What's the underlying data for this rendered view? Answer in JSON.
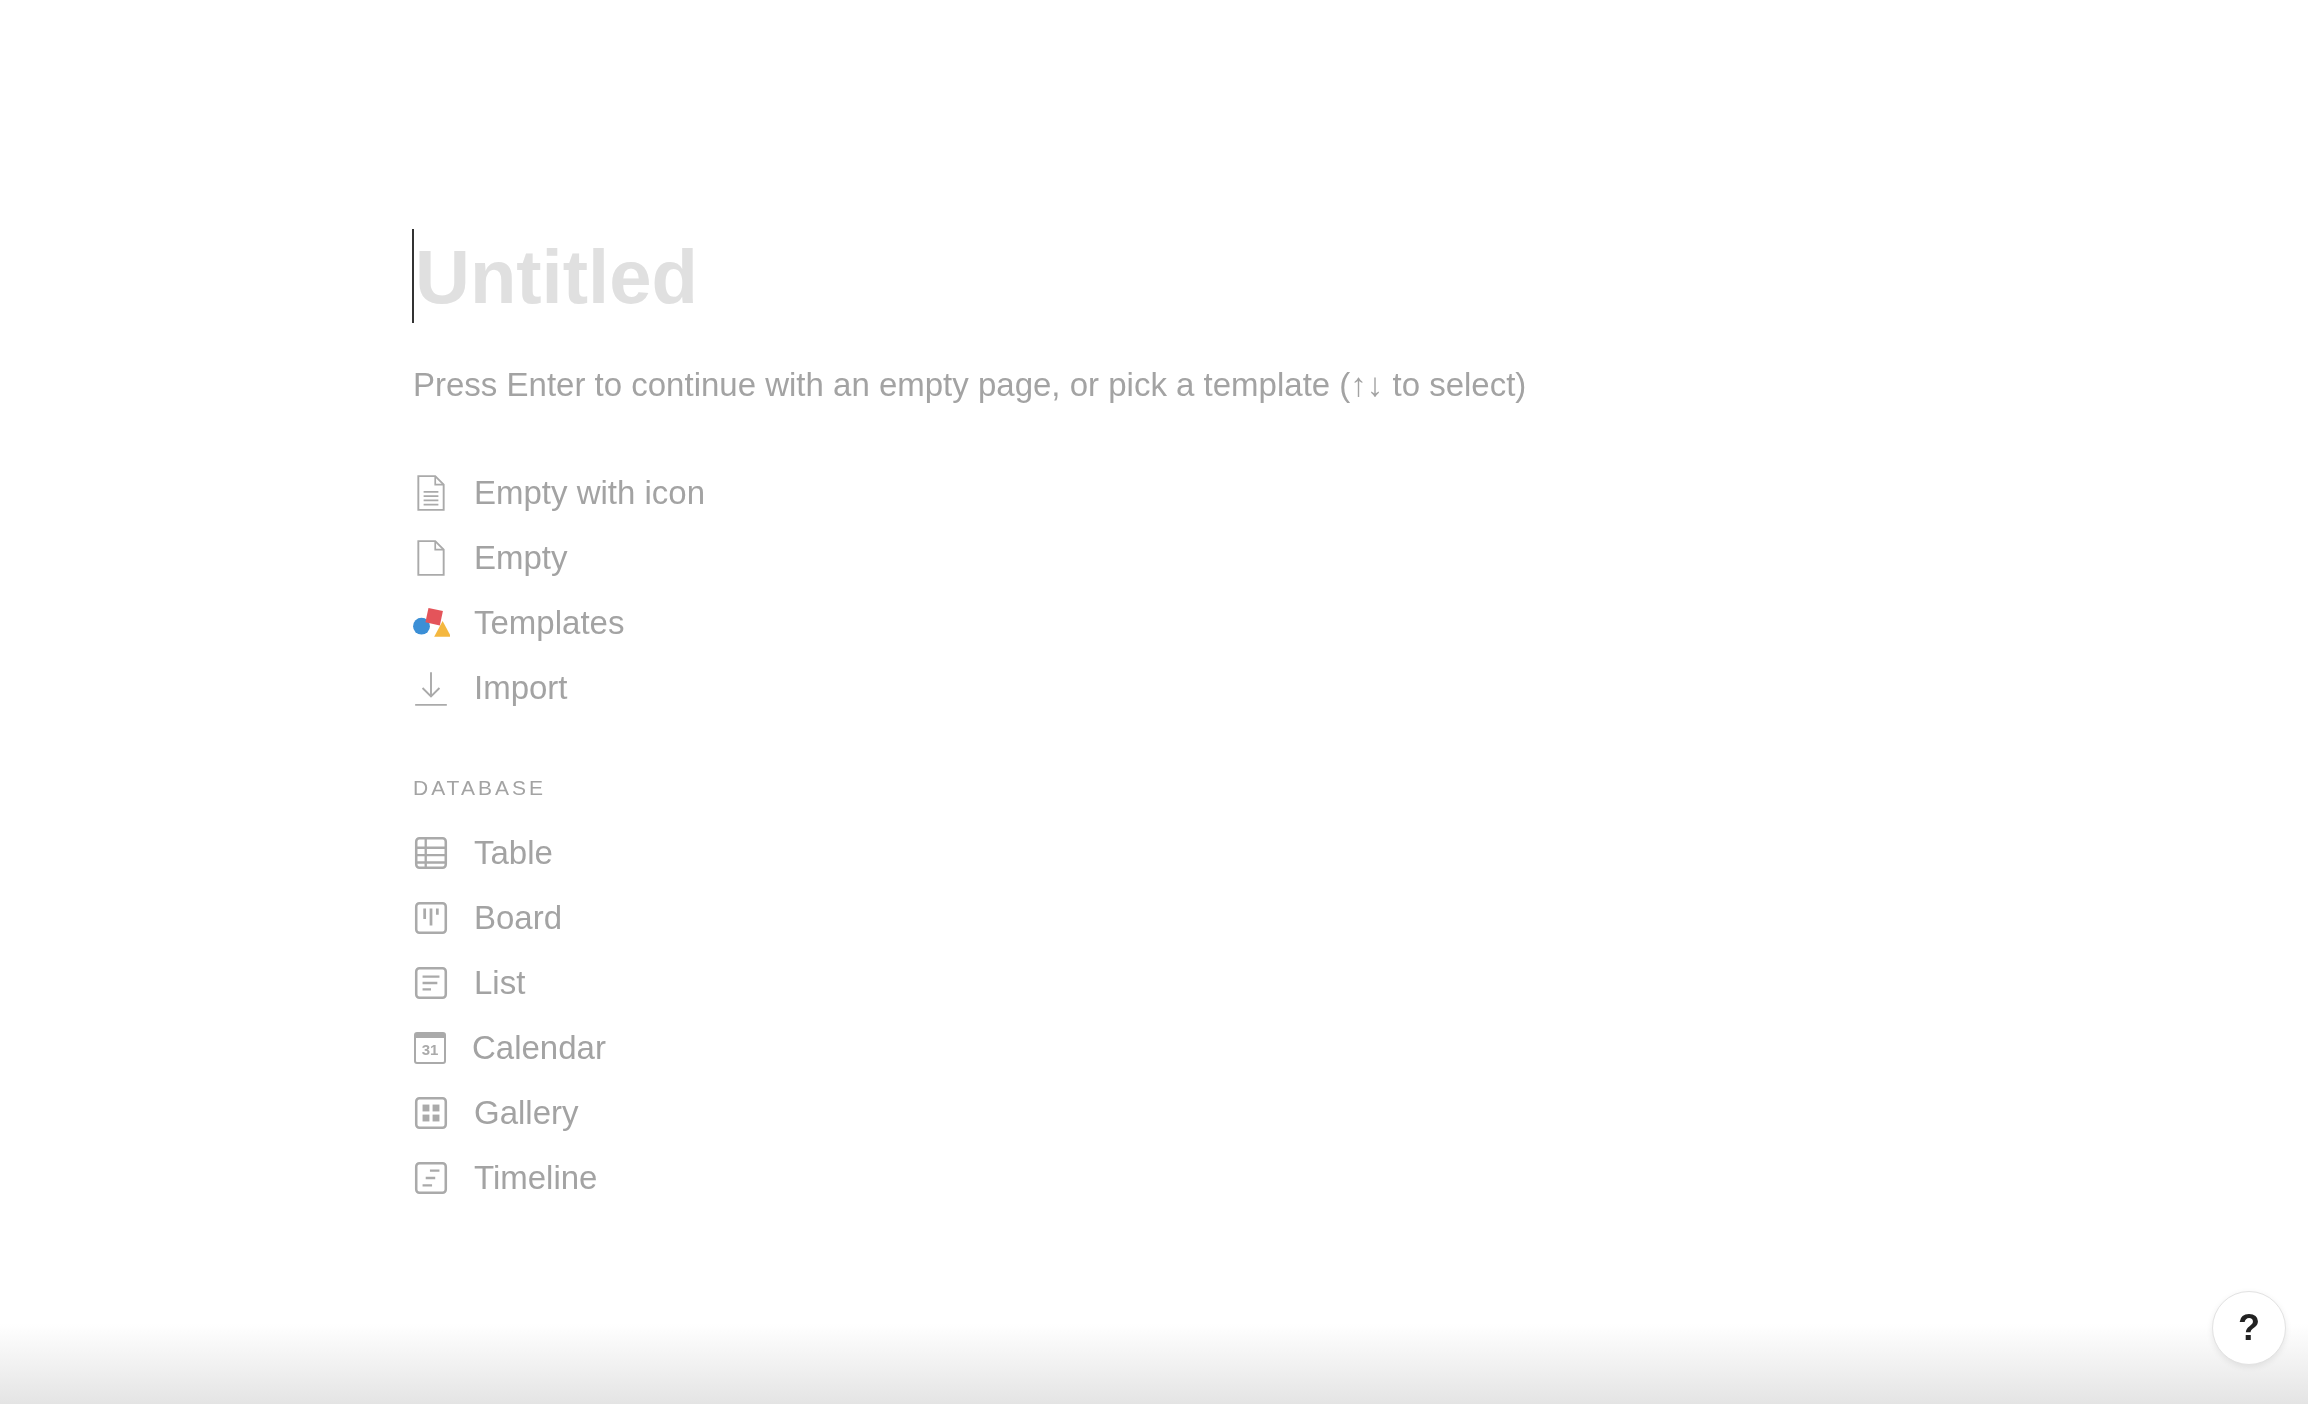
{
  "page": {
    "title_placeholder": "Untitled",
    "hint": "Press Enter to continue with an empty page, or pick a template (↑↓ to select)"
  },
  "options": [
    {
      "kind": "doc-lines",
      "label": "Empty with icon"
    },
    {
      "kind": "doc",
      "label": "Empty"
    },
    {
      "kind": "shapes",
      "label": "Templates"
    },
    {
      "kind": "download",
      "label": "Import"
    }
  ],
  "database": {
    "heading": "DATABASE",
    "items": [
      {
        "kind": "table",
        "label": "Table"
      },
      {
        "kind": "board",
        "label": "Board"
      },
      {
        "kind": "list",
        "label": "List"
      },
      {
        "kind": "calendar",
        "label": "Calendar",
        "icon_text": "31"
      },
      {
        "kind": "gallery",
        "label": "Gallery"
      },
      {
        "kind": "timeline",
        "label": "Timeline"
      }
    ]
  },
  "help_button": {
    "label": "?"
  }
}
